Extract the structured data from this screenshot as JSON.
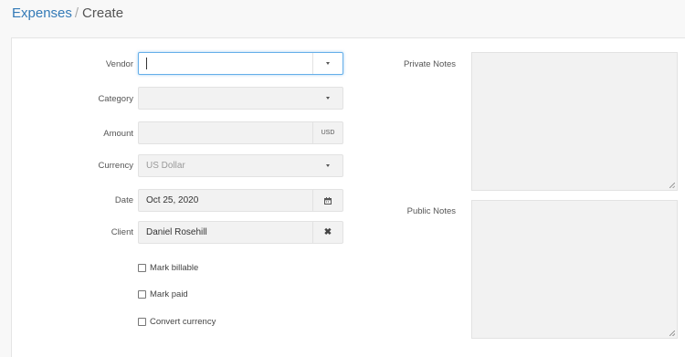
{
  "breadcrumb": {
    "parent": "Expenses",
    "separator": "/",
    "current": "Create"
  },
  "form": {
    "vendor": {
      "label": "Vendor",
      "value": ""
    },
    "category": {
      "label": "Category",
      "value": ""
    },
    "amount": {
      "label": "Amount",
      "value": "",
      "currency_addon": "USD"
    },
    "currency": {
      "label": "Currency",
      "value": "US Dollar"
    },
    "date": {
      "label": "Date",
      "value": "Oct 25, 2020",
      "icon": "calendar-icon"
    },
    "client": {
      "label": "Client",
      "value": "Daniel Rosehill",
      "clear_icon": "close-icon"
    },
    "checkboxes": {
      "mark_billable": {
        "label": "Mark billable",
        "checked": false
      },
      "mark_paid": {
        "label": "Mark paid",
        "checked": false
      },
      "convert_currency": {
        "label": "Convert currency",
        "checked": false
      }
    },
    "private_notes": {
      "label": "Private Notes",
      "value": ""
    },
    "public_notes": {
      "label": "Public Notes",
      "value": ""
    }
  },
  "colors": {
    "link": "#337ab7",
    "focus_border": "#66afe9",
    "input_bg": "#f2f2f2"
  }
}
